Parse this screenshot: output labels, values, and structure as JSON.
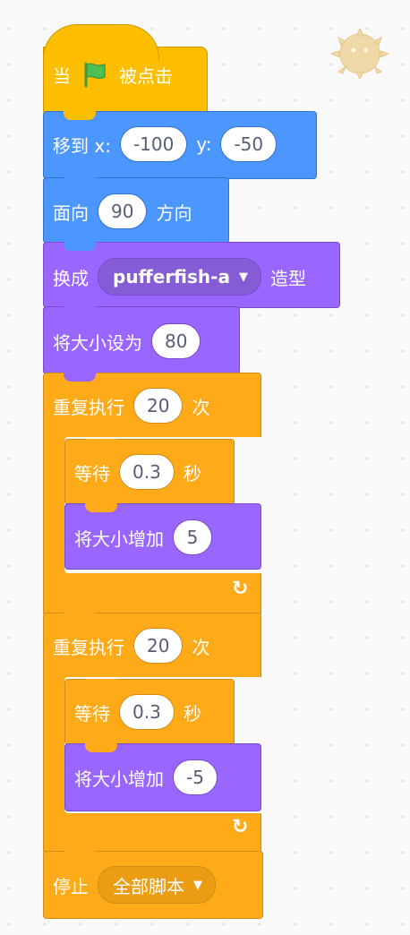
{
  "sprite": {
    "icon": "pufferfish-icon"
  },
  "blocks": {
    "when_flag": {
      "prefix": "当",
      "flag_icon": "green-flag-icon",
      "suffix": "被点击"
    },
    "goto": {
      "label": "移到 x:",
      "x": "-100",
      "y_label": "y:",
      "y": "-50"
    },
    "point": {
      "label": "面向",
      "value": "90",
      "suffix": "方向"
    },
    "costume": {
      "label": "换成",
      "value": "pufferfish-a",
      "suffix": "造型"
    },
    "set_size": {
      "label": "将大小设为",
      "value": "80"
    },
    "repeat1": {
      "label": "重复执行",
      "value": "20",
      "suffix": "次"
    },
    "wait1": {
      "label": "等待",
      "value": "0.3",
      "suffix": "秒"
    },
    "change1": {
      "label": "将大小增加",
      "value": "5"
    },
    "repeat2": {
      "label": "重复执行",
      "value": "20",
      "suffix": "次"
    },
    "wait2": {
      "label": "等待",
      "value": "0.3",
      "suffix": "秒"
    },
    "change2": {
      "label": "将大小增加",
      "value": "-5"
    },
    "stop": {
      "label": "停止",
      "value": "全部脚本"
    }
  },
  "colors": {
    "events": "#ffbf00",
    "motion": "#4c97ff",
    "looks": "#9966ff",
    "control": "#ffab19",
    "flag": "#4cbf56"
  }
}
